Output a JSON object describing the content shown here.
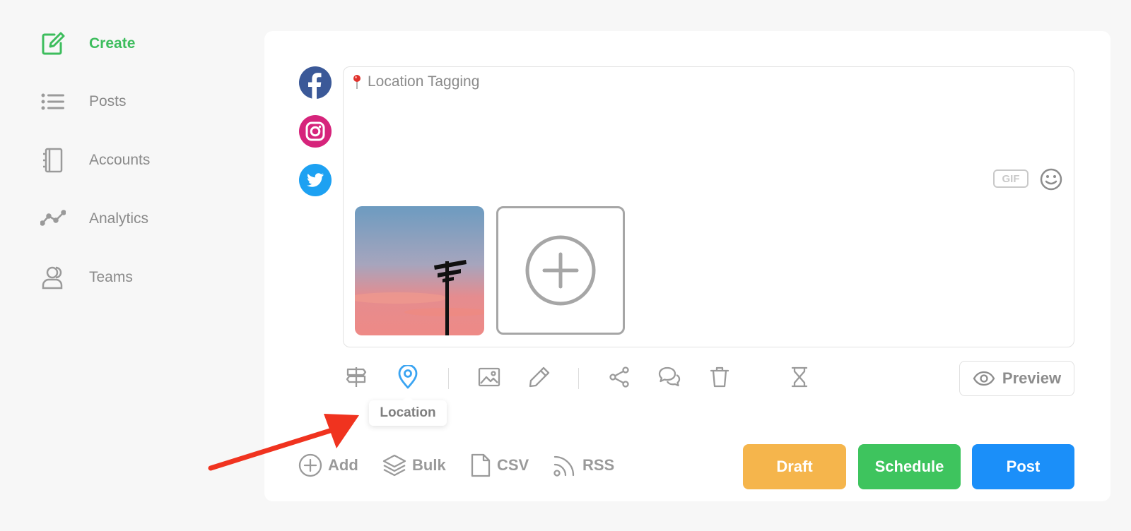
{
  "sidebar": {
    "items": [
      {
        "label": "Create",
        "icon": "edit-icon",
        "active": true
      },
      {
        "label": "Posts",
        "icon": "list-icon"
      },
      {
        "label": "Accounts",
        "icon": "notebook-icon"
      },
      {
        "label": "Analytics",
        "icon": "trend-line-icon"
      },
      {
        "label": "Teams",
        "icon": "users-icon"
      }
    ]
  },
  "composer": {
    "accounts": [
      "facebook-icon",
      "instagram-icon",
      "twitter-icon"
    ],
    "location_tag": "Location Tagging",
    "gif_label": "GIF",
    "toolbar_tooltip": "Location",
    "preview_label": "Preview"
  },
  "imports": {
    "add": "Add",
    "bulk": "Bulk",
    "csv": "CSV",
    "rss": "RSS"
  },
  "actions": {
    "draft": "Draft",
    "schedule": "Schedule",
    "post": "Post"
  },
  "colors": {
    "accent_green": "#3dbd5d",
    "draft": "#f5b54c",
    "schedule": "#3ec45e",
    "post": "#1b8ff9",
    "location_active": "#3aa4f2",
    "annotation_arrow": "#f0331f"
  }
}
